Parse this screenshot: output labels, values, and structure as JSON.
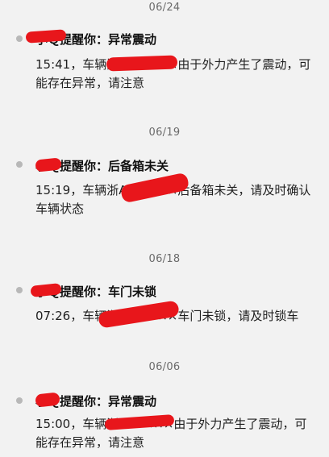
{
  "messages": [
    {
      "date": "06/24",
      "title": "小Ｑ提醒你：异常震动",
      "body": "15:41，车辆浙A×××××由于外力产生了震动，可能存在异常，请注意"
    },
    {
      "date": "06/19",
      "title": "小Ｑ提醒你：后备箱未关",
      "body": "15:19，车辆浙A×××××后备箱未关，请及时确认车辆状态"
    },
    {
      "date": "06/18",
      "title": "小Ｑ提醒你：车门未锁",
      "body": "07:26，车辆浙A×××××车门未锁，请及时锁车"
    },
    {
      "date": "06/06",
      "title": "小Ｑ提醒你：异常震动",
      "body": "15:00，车辆浙AA0×××由于外力产生了震动，可能存在异常，请注意"
    }
  ],
  "colors": {
    "background": "#f2f2f2",
    "redaction": "#e8161b",
    "date_text": "#6b6b6b",
    "dot": "#b8b8b8"
  }
}
